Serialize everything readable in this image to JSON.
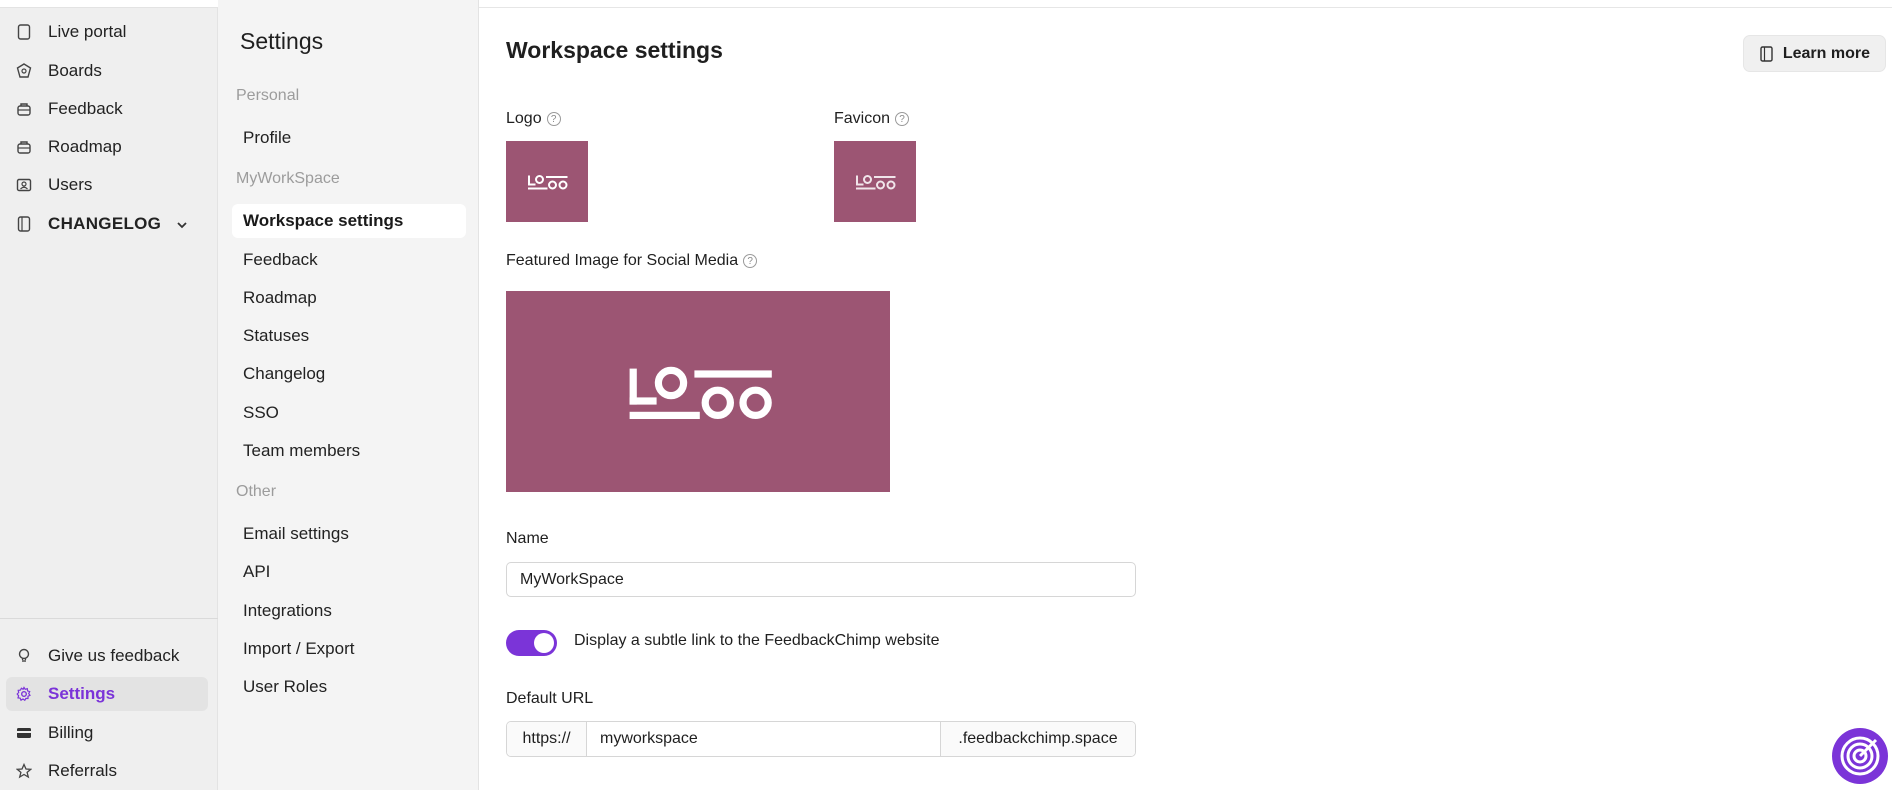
{
  "nav": {
    "items": [
      {
        "label": "Live portal",
        "icon": "portal-icon"
      },
      {
        "label": "Boards",
        "icon": "boards-icon"
      },
      {
        "label": "Feedback",
        "icon": "feedback-icon"
      },
      {
        "label": "Roadmap",
        "icon": "roadmap-icon"
      },
      {
        "label": "Users",
        "icon": "users-icon"
      },
      {
        "label": "CHANGELOG",
        "icon": "changelog-icon"
      }
    ],
    "bottom": [
      {
        "label": "Give us feedback",
        "icon": "bulb-icon"
      },
      {
        "label": "Settings",
        "icon": "gear-icon"
      },
      {
        "label": "Billing",
        "icon": "card-icon"
      },
      {
        "label": "Referrals",
        "icon": "star-icon"
      }
    ],
    "active": "Settings"
  },
  "menu": {
    "title": "Settings",
    "sections": [
      {
        "title": "Personal",
        "items": [
          "Profile"
        ]
      },
      {
        "title": "MyWorkSpace",
        "items": [
          "Workspace settings",
          "Feedback",
          "Roadmap",
          "Statuses",
          "Changelog",
          "SSO",
          "Team members"
        ]
      },
      {
        "title": "Other",
        "items": [
          "Email settings",
          "API",
          "Integrations",
          "Import / Export",
          "User Roles"
        ]
      }
    ],
    "active": "Workspace settings"
  },
  "main": {
    "title": "Workspace settings",
    "learn_more": "Learn more",
    "logo_label": "Logo",
    "favicon_label": "Favicon",
    "featured_label": "Featured Image for Social Media",
    "logo_text": "LOGO",
    "name_label": "Name",
    "name_value": "MyWorkSpace",
    "toggle_label": "Display a subtle link to the FeedbackChimp website",
    "toggle_on": true,
    "url_label": "Default URL",
    "url_prefix": "https://",
    "url_value": "myworkspace",
    "url_suffix": ".feedbackchimp.space"
  },
  "colors": {
    "accent": "#7b34d8",
    "logo_bg": "#9c5573"
  }
}
